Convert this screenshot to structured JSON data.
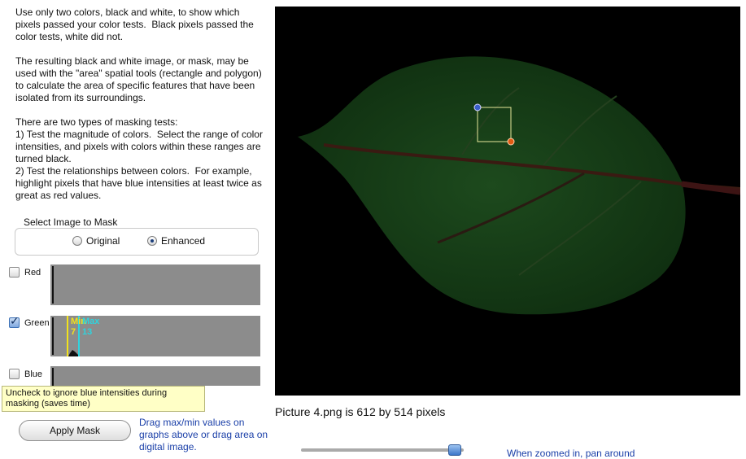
{
  "instructions": "Use only two colors, black and white, to show which pixels passed your color tests.  Black pixels passed the color tests, white did not.\n\nThe resulting black and white image, or mask, may be used with the \"area\" spatial tools (rectangle and polygon) to calculate the area of specific features that have been isolated from its surroundings.\n\nThere are two types of masking tests:\n1) Test the magnitude of colors.  Select the range of color intensities, and pixels with colors within these ranges are turned black.\n2) Test the relationships between colors.  For example, highlight pixels that have blue intensities at least twice as great as red values.",
  "select_image": {
    "label": "Select Image to Mask",
    "options": [
      {
        "label": "Original",
        "selected": false
      },
      {
        "label": "Enhanced",
        "selected": true
      }
    ]
  },
  "channels": {
    "red": {
      "label": "Red",
      "checked": false
    },
    "green": {
      "label": "Green",
      "checked": true,
      "min_label": "Min",
      "min_value": "7",
      "max_label": "Max",
      "max_value": "13",
      "min_color": "#f2e21c",
      "max_color": "#2fd3dd"
    },
    "blue": {
      "label": "Blue",
      "checked": false
    }
  },
  "tooltip": "Uncheck to ignore blue intensities during masking (saves time)",
  "apply_button": "Apply Mask",
  "drag_note": "Drag max/min values on graphs above or drag area on digital image.",
  "image_caption": "Picture 4.png is 612 by 514 pixels",
  "zoom_note": "When zoomed in, pan around",
  "colors": {
    "link": "#1a3fa8",
    "leaf": "#123a12",
    "vein": "#3a1a12",
    "histogram": "#8c8c8c"
  }
}
